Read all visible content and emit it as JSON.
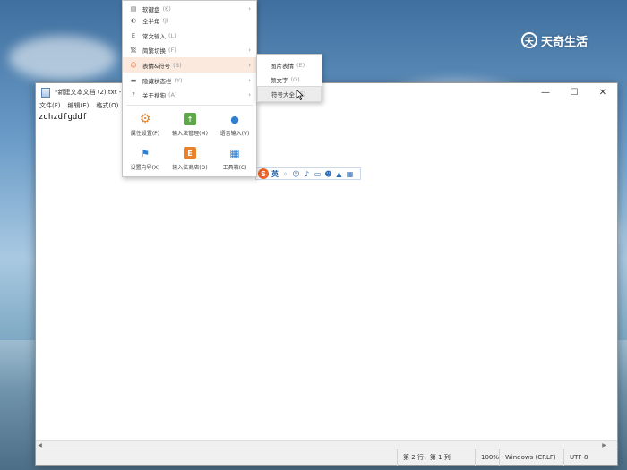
{
  "watermark": {
    "logo": "天",
    "text": "天奇生活"
  },
  "notepad": {
    "title": "*新建文本文档 (2).txt - 记",
    "controls": {
      "minimize": "—",
      "maximize": "☐",
      "close": "✕"
    },
    "menu": [
      "文件(F)",
      "编辑(E)",
      "格式(O)"
    ],
    "content": "zdhzdfgddf",
    "status": {
      "position": "第 2 行，第 1 列",
      "zoom": "100%",
      "eol": "Windows (CRLF)",
      "encoding": "UTF-8"
    }
  },
  "ime_toolbar": {
    "logo": "S",
    "lang": "英"
  },
  "context_menu": {
    "items": [
      {
        "label": "软键盘",
        "hotkey": "(K)"
      },
      {
        "label": "全半角",
        "hotkey": "(J)"
      },
      {
        "label": "常文输入",
        "hotkey": "(L)"
      },
      {
        "label": "简繁切换",
        "hotkey": "(F)"
      },
      {
        "label": "表情&符号",
        "hotkey": "(B)"
      },
      {
        "label": "隐藏状态栏",
        "hotkey": "(Y)"
      },
      {
        "label": "关于搜狗",
        "hotkey": "(A)"
      }
    ],
    "tiles": [
      {
        "label": "属性设置(P)",
        "icon": "gear-icon",
        "color": "#e8822c"
      },
      {
        "label": "输入法管理(M)",
        "icon": "upload-icon",
        "color": "#5fa84a"
      },
      {
        "label": "语音输入(V)",
        "icon": "microphone-icon",
        "color": "#2f7fd0"
      },
      {
        "label": "设置向导(X)",
        "icon": "flag-icon",
        "color": "#2f7fd0"
      },
      {
        "label": "输入法商店(O)",
        "icon": "store-icon",
        "color": "#e8822c"
      },
      {
        "label": "工具箱(C)",
        "icon": "grid-icon",
        "color": "#2f7fd0"
      }
    ]
  },
  "submenu": {
    "items": [
      {
        "label": "图片表情",
        "hotkey": "(E)"
      },
      {
        "label": "颜文字",
        "hotkey": "(O)"
      },
      {
        "label": "符号大全",
        "hotkey": "(S)"
      }
    ]
  }
}
